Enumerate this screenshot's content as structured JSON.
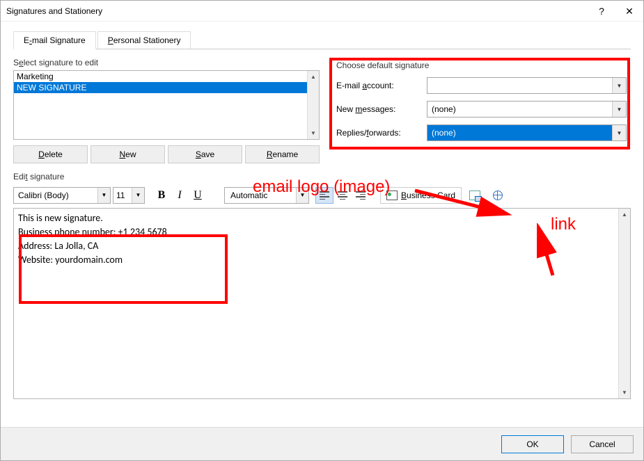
{
  "window": {
    "title": "Signatures and Stationery",
    "help": "?",
    "close": "✕"
  },
  "tabs": {
    "email_pre": "E",
    "email_u": "-",
    "email_post": "mail Signature",
    "stationery_u": "P",
    "stationery_rest": "ersonal Stationery"
  },
  "select_label_pre": "S",
  "select_label_u": "e",
  "select_label_post": "lect signature to edit",
  "signatures": {
    "item0": "Marketing",
    "item1": "NEW SIGNATURE"
  },
  "buttons": {
    "delete_u": "D",
    "delete_rest": "elete",
    "new_u": "N",
    "new_rest": "ew",
    "save_u": "S",
    "save_rest": "ave",
    "rename_u": "R",
    "rename_rest": "ename"
  },
  "defaults": {
    "title": "Choose default signature",
    "account_pre": "E-mail ",
    "account_u": "a",
    "account_post": "ccount:",
    "account_value": "",
    "newmsg_pre": "New ",
    "newmsg_u": "m",
    "newmsg_post": "essages:",
    "newmsg_value": "(none)",
    "replies_pre": "Replies/",
    "replies_u": "f",
    "replies_post": "orwards:",
    "replies_value": "(none)"
  },
  "edit_label_pre": "Edi",
  "edit_label_u": "t",
  "edit_label_post": " signature",
  "toolbar": {
    "font": "Calibri (Body)",
    "size": "11",
    "color": "Automatic",
    "bizcard_u": "B",
    "bizcard_rest": "usiness Card"
  },
  "signature_text": {
    "l1": "This is new signature.",
    "l2": "Business phone number: +1 234 5678",
    "l3": "Address: La Jolla, CA",
    "l4": "Website: yourdomain.com"
  },
  "footer": {
    "ok": "OK",
    "cancel": "Cancel"
  },
  "annotations": {
    "logo": "email logo (image)",
    "link": "link"
  }
}
